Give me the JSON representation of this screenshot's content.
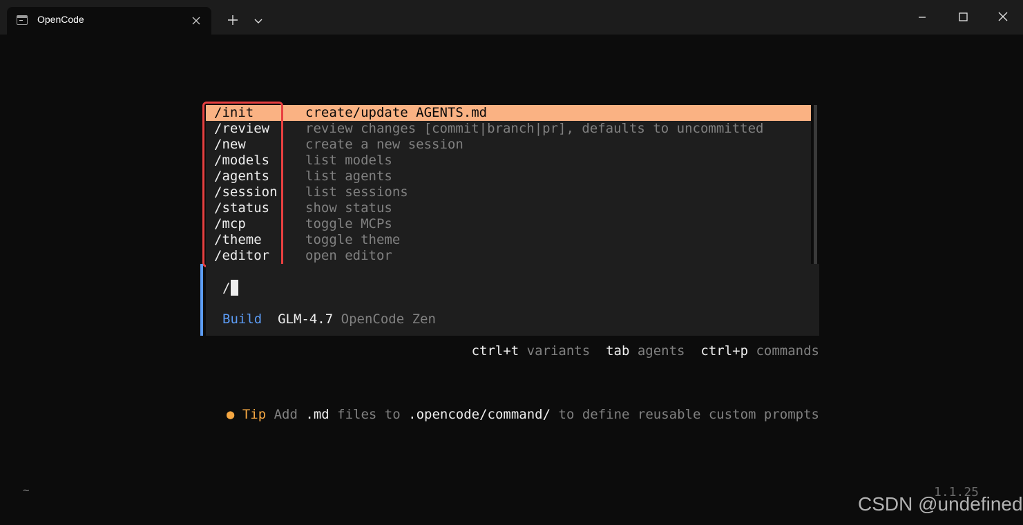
{
  "window": {
    "tab_title": "OpenCode"
  },
  "menu": {
    "items": [
      {
        "cmd": "/init",
        "desc": "create/update AGENTS.md",
        "selected": true
      },
      {
        "cmd": "/review",
        "desc": "review changes [commit|branch|pr], defaults to uncommitted"
      },
      {
        "cmd": "/new",
        "desc": "create a new session"
      },
      {
        "cmd": "/models",
        "desc": "list models"
      },
      {
        "cmd": "/agents",
        "desc": "list agents"
      },
      {
        "cmd": "/session",
        "desc": "list sessions"
      },
      {
        "cmd": "/status",
        "desc": "show status"
      },
      {
        "cmd": "/mcp",
        "desc": "toggle MCPs"
      },
      {
        "cmd": "/theme",
        "desc": "toggle theme"
      },
      {
        "cmd": "/editor",
        "desc": "open editor"
      }
    ]
  },
  "prompt": {
    "value": "/"
  },
  "status": {
    "agent": "Build",
    "model": "GLM-4.7",
    "provider": "OpenCode Zen"
  },
  "hints": [
    {
      "key": "ctrl+t",
      "label": "variants"
    },
    {
      "key": "tab",
      "label": "agents"
    },
    {
      "key": "ctrl+p",
      "label": "commands"
    }
  ],
  "tip": {
    "bullet": "●",
    "label": "Tip",
    "part1": "Add",
    "em1": ".md",
    "part2": "files to",
    "em2": ".opencode/command/",
    "part3": "to define reusable custom prompts"
  },
  "footer": {
    "cwd": "~",
    "version": "1.1.25",
    "watermark": "CSDN @undefined"
  },
  "colors": {
    "accent_blue": "#5c9cf5",
    "selection": "#fab283",
    "tip": "#f5a742",
    "highlight_box": "#e84040"
  },
  "icons": {
    "tab": "terminal-icon",
    "close_tab": "close-icon",
    "new_tab": "plus-icon",
    "dropdown": "chevron-down-icon",
    "minimize": "minimize-icon",
    "maximize": "maximize-icon",
    "close_window": "close-icon"
  }
}
